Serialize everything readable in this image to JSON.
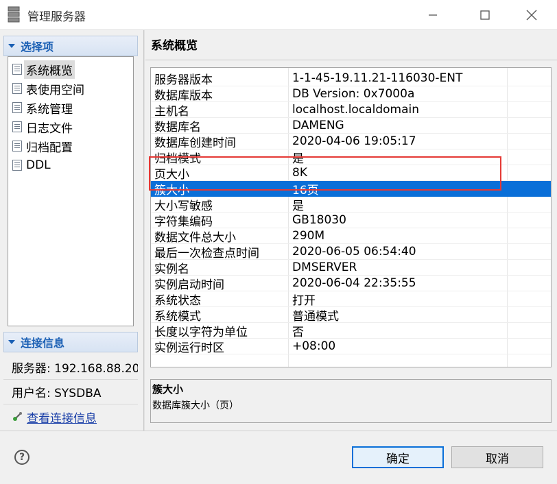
{
  "window": {
    "title": "管理服务器"
  },
  "left": {
    "options_header": "选择项",
    "nav_items": [
      {
        "label": "系统概览",
        "selected": true
      },
      {
        "label": "表使用空间",
        "selected": false
      },
      {
        "label": "系统管理",
        "selected": false
      },
      {
        "label": "日志文件",
        "selected": false
      },
      {
        "label": "归档配置",
        "selected": false
      },
      {
        "label": "DDL",
        "selected": false
      }
    ],
    "conn_header": "连接信息",
    "server_text": "服务器: 192.168.88.20",
    "user_text": "用户名: SYSDBA",
    "view_link": "查看连接信息"
  },
  "main": {
    "title": "系统概览",
    "rows": [
      {
        "key": "服务器版本",
        "value": "1-1-45-19.11.21-116030-ENT"
      },
      {
        "key": "数据库版本",
        "value": "DB Version: 0x7000a"
      },
      {
        "key": "主机名",
        "value": "localhost.localdomain"
      },
      {
        "key": "数据库名",
        "value": "DAMENG"
      },
      {
        "key": "数据库创建时间",
        "value": "2020-04-06 19:05:17"
      },
      {
        "key": "归档模式",
        "value": "是"
      },
      {
        "key": "页大小",
        "value": "8K"
      },
      {
        "key": "簇大小",
        "value": "16页"
      },
      {
        "key": "大小写敏感",
        "value": "是"
      },
      {
        "key": "字符集编码",
        "value": "GB18030"
      },
      {
        "key": "数据文件总大小",
        "value": "290M"
      },
      {
        "key": "最后一次检查点时间",
        "value": "2020-06-05 06:54:40"
      },
      {
        "key": "实例名",
        "value": "DMSERVER"
      },
      {
        "key": "实例启动时间",
        "value": "2020-06-04 22:35:55"
      },
      {
        "key": "系统状态",
        "value": "打开"
      },
      {
        "key": "系统模式",
        "value": "普通模式"
      },
      {
        "key": "长度以字符为单位",
        "value": "否"
      },
      {
        "key": "实例运行时区",
        "value": "+08:00"
      }
    ],
    "selected_row": 7,
    "desc_title": "簇大小",
    "desc_text": "数据库簇大小（页）"
  },
  "buttons": {
    "help": "?",
    "ok": "确定",
    "cancel": "取消"
  },
  "colors": {
    "accent": "#1a5fb4",
    "selection": "#0a6fd8",
    "highlight": "#e53935"
  }
}
